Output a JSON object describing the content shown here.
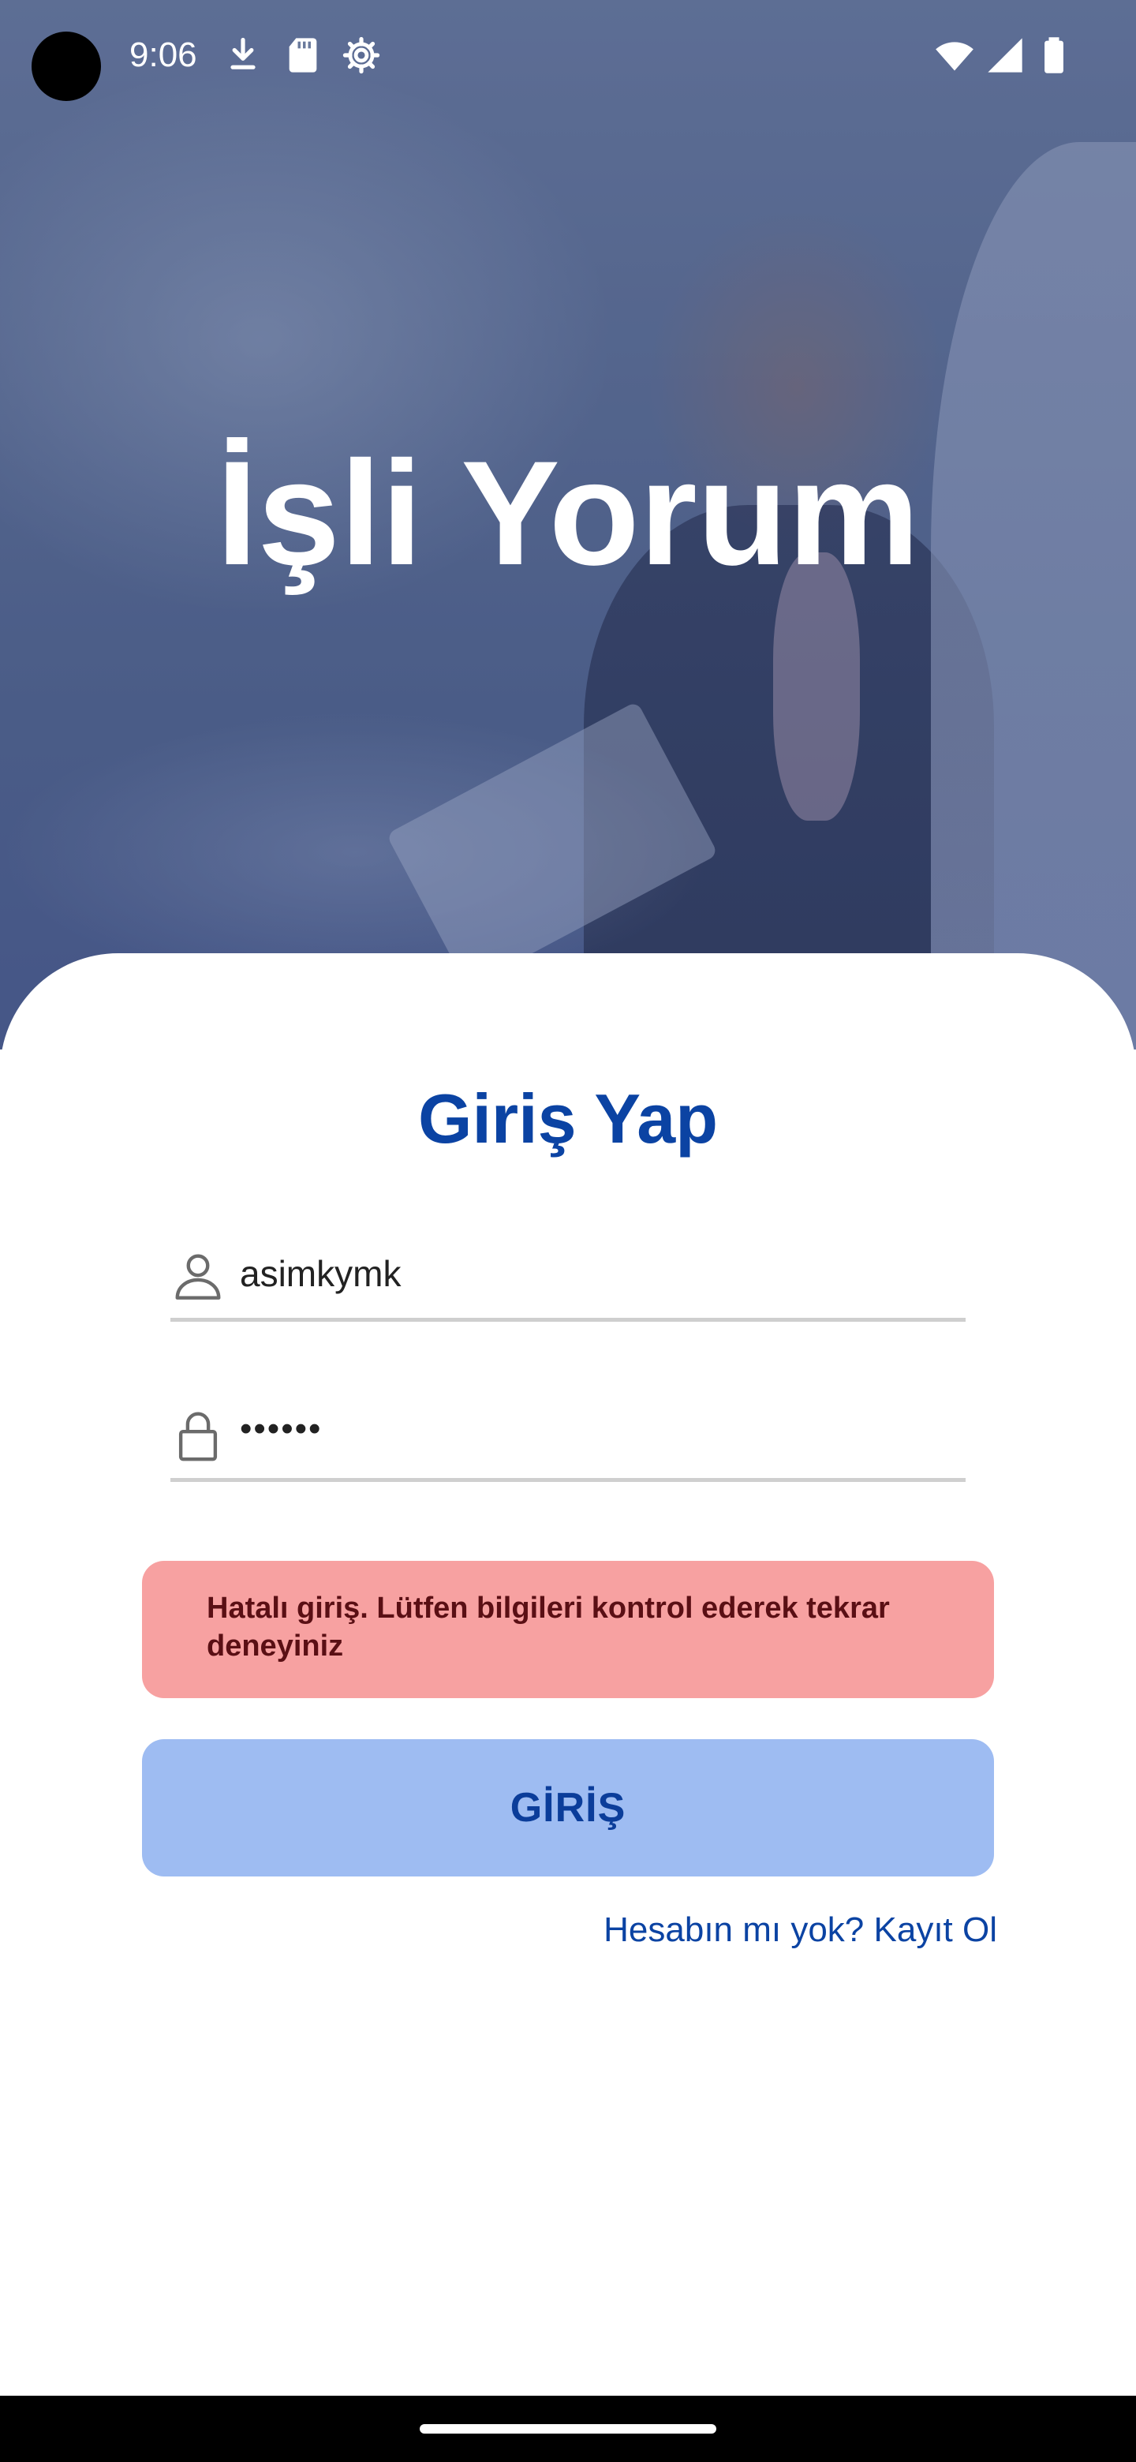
{
  "status_bar": {
    "time": "9:06",
    "icons": [
      "download-icon",
      "sd-card-icon",
      "settings-icon",
      "wifi-icon",
      "signal-icon",
      "battery-icon"
    ]
  },
  "hero": {
    "title": "İşli Yorum"
  },
  "login": {
    "heading": "Giriş Yap",
    "username": {
      "value": "asimkymk",
      "icon": "user-icon"
    },
    "password": {
      "value": "••••••",
      "icon": "lock-icon"
    },
    "error_message": "Hatalı giriş. Lütfen bilgileri kontrol ederek tekrar deneyiniz",
    "submit_label": "GİRİŞ",
    "register_link": "Hesabın mı yok? Kayıt Ol"
  },
  "colors": {
    "primary": "#0b43a3",
    "button_bg": "#9ebcf2",
    "error_bg": "#f7a1a1",
    "error_text": "#5a0f14"
  }
}
